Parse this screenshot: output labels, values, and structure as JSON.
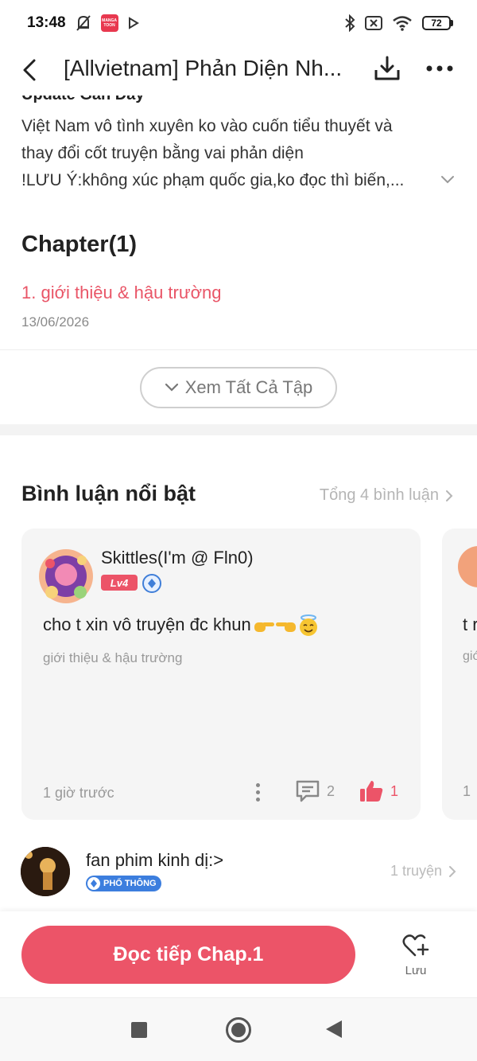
{
  "status_bar": {
    "time": "13:48",
    "app_badge": "MANGA TOON",
    "battery": "72",
    "icons": [
      "mute-bell-icon",
      "app-badge-icon",
      "play-icon",
      "bluetooth-icon",
      "sim-off-icon",
      "wifi-icon",
      "battery-icon"
    ]
  },
  "header": {
    "title": "[Allvietnam] Phản Diện Nh...",
    "icons": [
      "back-icon",
      "download-icon",
      "more-icon"
    ]
  },
  "description": {
    "heading": "Update Gần Đây",
    "lines": [
      "Việt Nam vô tình xuyên ko vào cuốn tiểu thuyết và",
      "thay đổi cốt truyện bằng vai phản diện",
      "!LƯU Ý:không xúc phạm quốc gia,ko đọc thì biến,..."
    ]
  },
  "chapters": {
    "heading": "Chapter(1)",
    "items": [
      {
        "title": "1. giới thiệu & hậu trường",
        "date": "13/06/2026"
      }
    ],
    "see_all_label": "Xem Tất Cả Tập"
  },
  "comments": {
    "heading": "Bình luận nổi bật",
    "total_label": "Tổng 4 bình luận",
    "items": [
      {
        "user": "Skittles(I'm @ Fln0)",
        "level": "Lv4",
        "text": "cho t xin vô truyện đc khun",
        "chapter": "giới thiệu & hậu trường",
        "time": "1 giờ trước",
        "replies": "2",
        "likes": "1"
      },
      {
        "text": "t r",
        "chapter": "giớ",
        "time": "1"
      }
    ]
  },
  "author": {
    "name": "fan phim kinh dị:>",
    "badge": "PHỔ THÔNG",
    "works": "1 truyện"
  },
  "bottom_bar": {
    "read_label": "Đọc tiếp Chap.1",
    "save_label": "Lưu"
  },
  "colors": {
    "accent": "#ec5468",
    "chapter_link": "#e95567",
    "vip_blue": "#3c7ede"
  }
}
